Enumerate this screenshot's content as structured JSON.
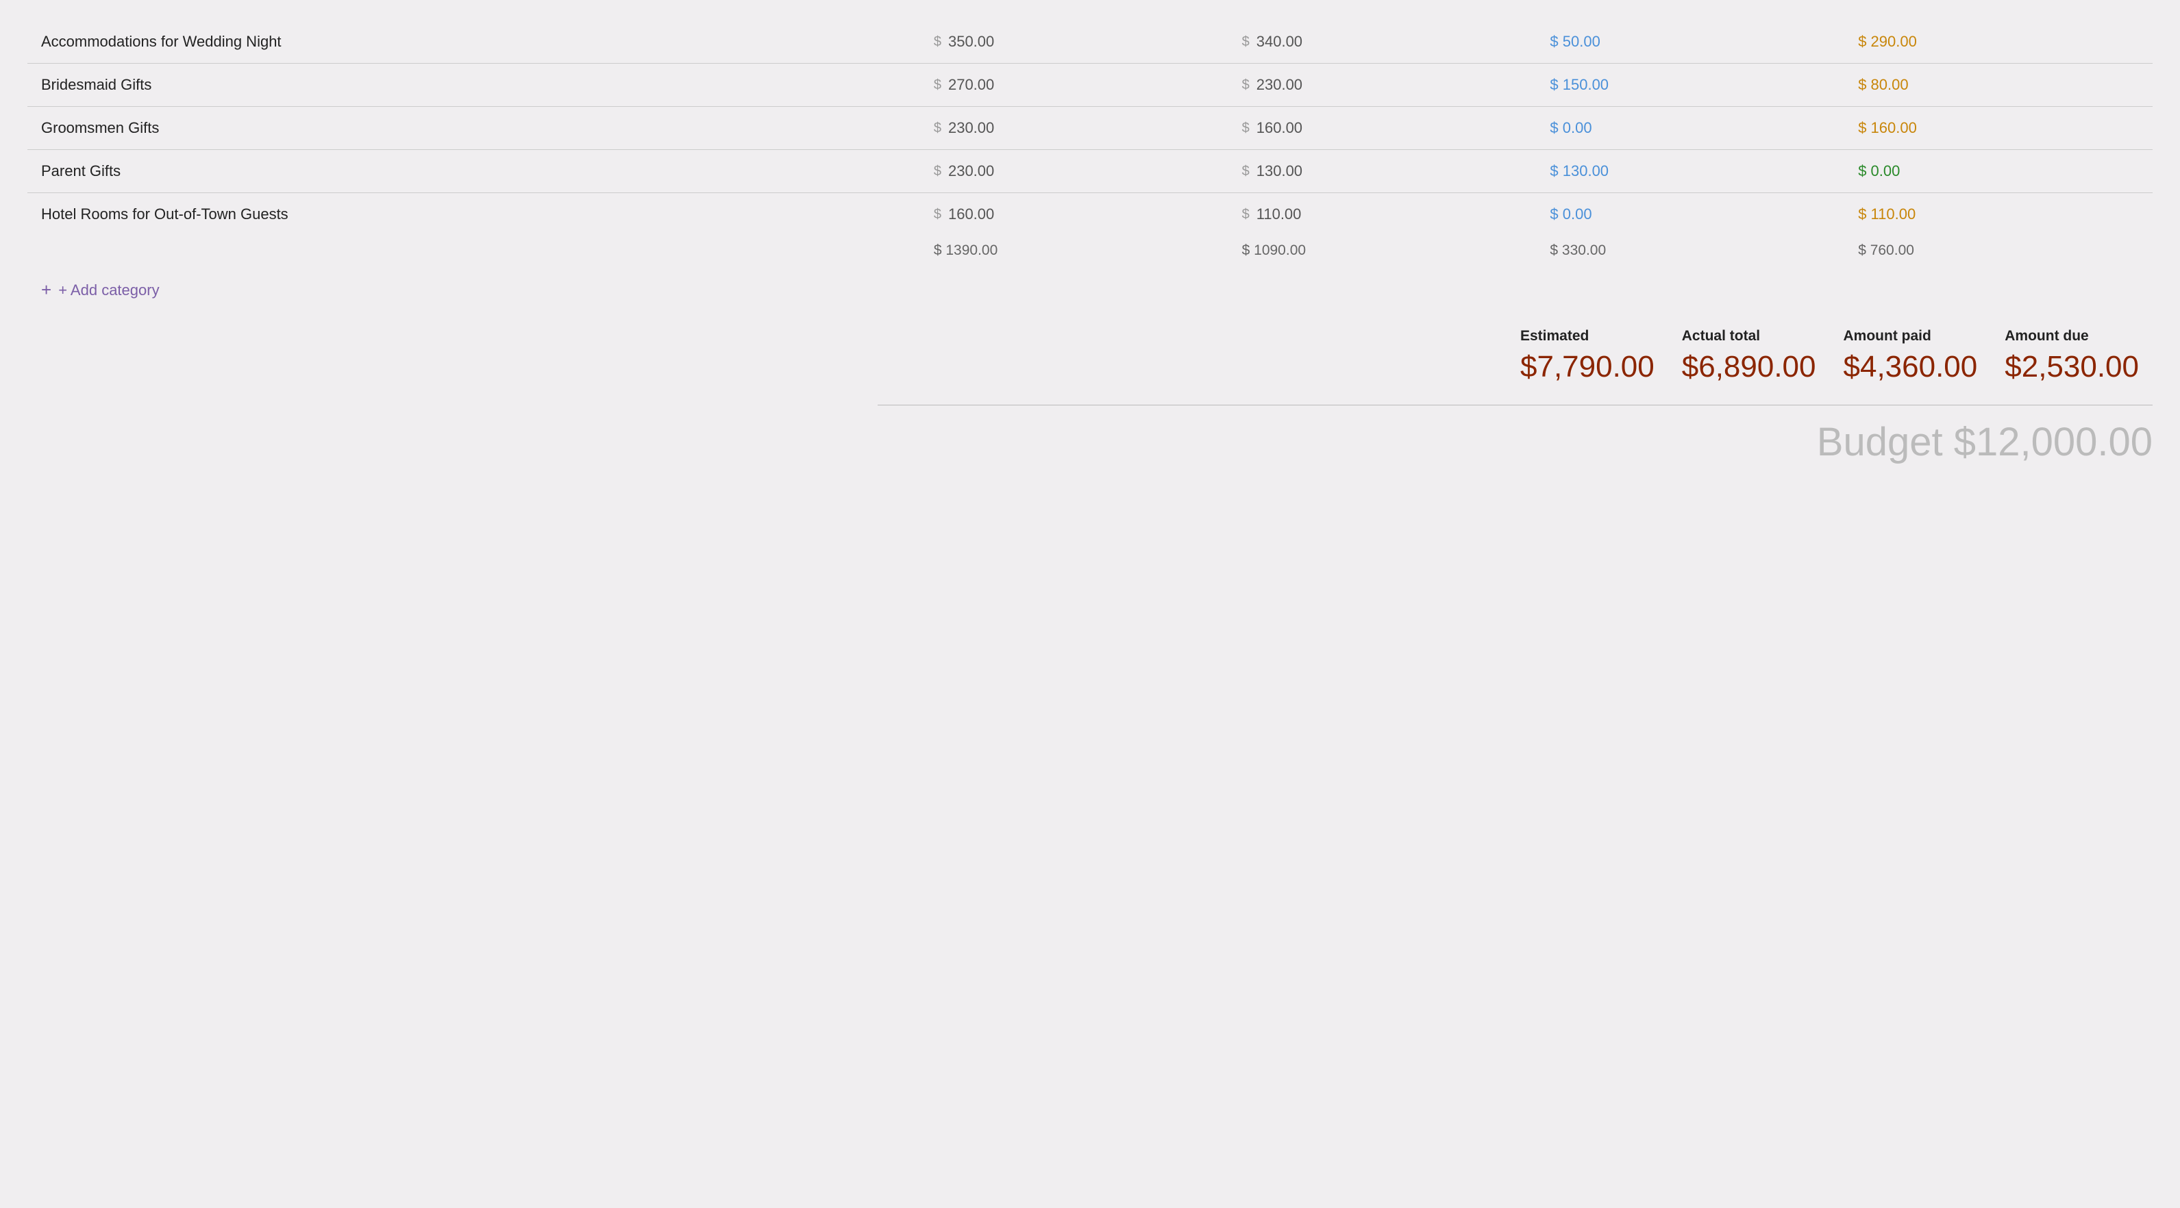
{
  "rows": [
    {
      "name": "Accommodations for Wedding Night",
      "estimated": "350.00",
      "actual": "340.00",
      "paid": "50.00",
      "due": "290.00",
      "paid_color": "blue",
      "due_color": "orange"
    },
    {
      "name": "Bridesmaid Gifts",
      "estimated": "270.00",
      "actual": "230.00",
      "paid": "150.00",
      "due": "80.00",
      "paid_color": "blue",
      "due_color": "orange"
    },
    {
      "name": "Groomsmen Gifts",
      "estimated": "230.00",
      "actual": "160.00",
      "paid": "0.00",
      "due": "160.00",
      "paid_color": "blue",
      "due_color": "orange"
    },
    {
      "name": "Parent Gifts",
      "estimated": "230.00",
      "actual": "130.00",
      "paid": "130.00",
      "due": "0.00",
      "paid_color": "blue",
      "due_color": "green"
    },
    {
      "name": "Hotel Rooms for Out-of-Town Guests",
      "estimated": "160.00",
      "actual": "110.00",
      "paid": "0.00",
      "due": "110.00",
      "paid_color": "blue",
      "due_color": "orange"
    }
  ],
  "subtotals": {
    "estimated": "$ 1390.00",
    "actual": "$ 1090.00",
    "paid": "$ 330.00",
    "due": "$ 760.00"
  },
  "add_category_label": "+ Add category",
  "totals": {
    "estimated_label": "Estimated",
    "estimated_value": "$7,790.00",
    "actual_label": "Actual total",
    "actual_value": "$6,890.00",
    "paid_label": "Amount paid",
    "paid_value": "$4,360.00",
    "due_label": "Amount due",
    "due_value": "$2,530.00"
  },
  "budget_label": "Budget $12,000.00"
}
